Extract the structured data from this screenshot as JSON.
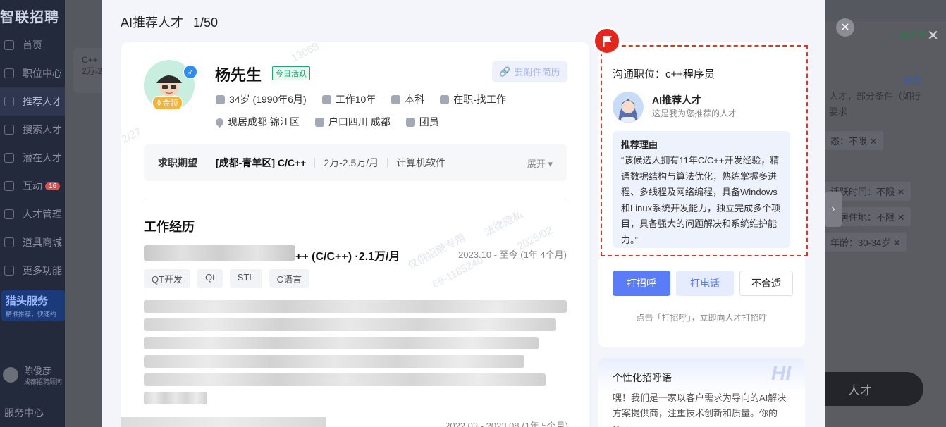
{
  "background": {
    "brand": "智联招聘",
    "nav": [
      {
        "label": "首页"
      },
      {
        "label": "职位中心"
      },
      {
        "label": "推荐人才"
      },
      {
        "label": "搜索人才"
      },
      {
        "label": "潜在人才"
      },
      {
        "label": "互动",
        "badge": "16"
      },
      {
        "label": "人才管理"
      },
      {
        "label": "道具商城"
      },
      {
        "label": "更多功能"
      }
    ],
    "promo": {
      "title": "猎头服务",
      "sub": "精准推荐，快速约"
    },
    "user": {
      "name": "陈俊彦",
      "sub": "成都招聘顾问"
    },
    "bottom_item": "服务中心",
    "left_card": {
      "line1": "C++",
      "line2": "2万-2"
    },
    "status": "• 服务中",
    "modify": "修改",
    "right_texts": [
      "人才，部分条件（如行",
      "要求"
    ],
    "chips": [
      "态：不限",
      "活跃时间：不限",
      "现居住地：不限",
      "年龄：30-34岁"
    ],
    "talent_button": "人才"
  },
  "modal": {
    "title": "AI推荐人才",
    "counter": "1/50",
    "candidate": {
      "name": "杨先生",
      "active_tag": "今日活跃",
      "badge": "金领",
      "attach_button": "要附件简历",
      "row1": [
        "34岁 (1990年6月)",
        "工作10年",
        "本科",
        "在职-找工作"
      ],
      "row2": [
        "现居成都 锦江区",
        "户口四川 成都",
        "团员"
      ]
    },
    "expectation": {
      "label": "求职期望",
      "position": "[成都-青羊区]  C/C++",
      "salary": "2万-2.5万/月",
      "industry": "计算机软件",
      "expand": "展开"
    },
    "work": {
      "section_title": "工作经历",
      "job_title": "++ (C/C++)  ·2.1万/月",
      "job_date": "2023.10 - 至今 (1年 4个月)",
      "skills": [
        "QT开发",
        "Qt",
        "STL",
        "C语言"
      ],
      "job2_date": "2022.03 - 2023.08 (1年 5个月)"
    },
    "watermarks": [
      "13068",
      "2/27",
      "仅供招聘专用",
      "法律隐私",
      "69-1185240",
      "2025/02"
    ],
    "recommendation": {
      "comm_position": "沟通职位：c++程序员",
      "ai_name": "AI推荐人才",
      "ai_sub": "这是我为您推荐的人才",
      "reason_title": "推荐理由",
      "reason_text": "“该候选人拥有11年C/C++开发经验，精通数据结构与算法优化，熟练掌握多进程、多线程及网络编程，具备Windows和Linux系统开发能力，独立完成多个项目，具备强大的问题解决和系统维护能力。”",
      "buttons": {
        "greet": "打招呼",
        "call": "打电话",
        "reject": "不合适"
      },
      "tip": "点击「打招呼」，立即向人才打招呼"
    },
    "greeting": {
      "title": "个性化招呼语",
      "hi": "HI",
      "text": "嘿！我们是一家以客户需求为导向的AI解决方案提供商，注重技术创新和质量。你的C++..."
    }
  },
  "colors": {
    "primary": "#5a7cf6",
    "highlight": "#d23a2e",
    "active_green": "#1aa870"
  }
}
